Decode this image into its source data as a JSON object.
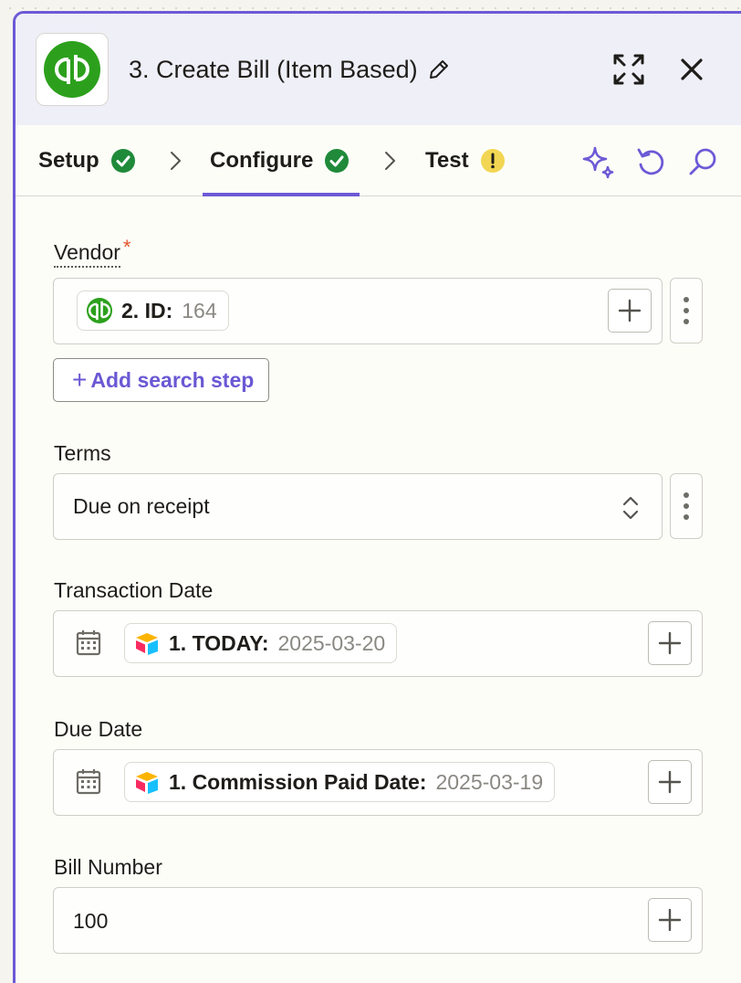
{
  "header": {
    "title": "3. Create Bill (Item Based)",
    "app_icon": "quickbooks-logo",
    "expand_icon": "expand-icon",
    "close_icon": "close-icon"
  },
  "tabs": [
    {
      "label": "Setup",
      "status": "complete"
    },
    {
      "label": "Configure",
      "status": "complete",
      "active": true
    },
    {
      "label": "Test",
      "status": "warning"
    }
  ],
  "tools": [
    "ai-sparkle-icon",
    "refresh-icon",
    "search-icon"
  ],
  "fields": {
    "vendor": {
      "label": "Vendor",
      "required": true,
      "pill": {
        "source_icon": "quickbooks-logo",
        "key": "2. ID:",
        "value": "164"
      },
      "add_search_label": "Add search step",
      "add_search_plus": "+"
    },
    "terms": {
      "label": "Terms",
      "value": "Due on receipt"
    },
    "transaction_date": {
      "label": "Transaction Date",
      "pill": {
        "source_icon": "airtable-logo",
        "key": "1. TODAY:",
        "value": "2025-03-20"
      }
    },
    "due_date": {
      "label": "Due Date",
      "pill": {
        "source_icon": "airtable-logo",
        "key": "1. Commission Paid Date:",
        "value": "2025-03-19"
      }
    },
    "bill_number": {
      "label": "Bill Number",
      "value": "100"
    }
  },
  "colors": {
    "accent": "#6c5ad6",
    "success": "#1f8a3a",
    "warning": "#f2d653",
    "required": "#e4562a",
    "quickbooks": "#2ca01c"
  }
}
